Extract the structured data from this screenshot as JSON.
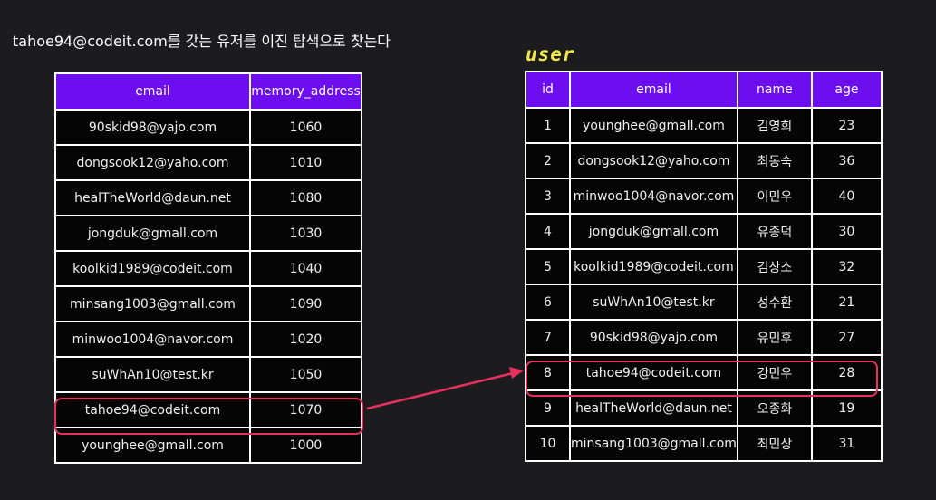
{
  "caption": "tahoe94@codeit.com를  갖는 유저를 이진 탐색으로 찾는다",
  "index_table": {
    "headers": [
      "email",
      "memory_address"
    ],
    "rows": [
      [
        "90skid98@yajo.com",
        "1060"
      ],
      [
        "dongsook12@yaho.com",
        "1010"
      ],
      [
        "healTheWorld@daun.net",
        "1080"
      ],
      [
        "jongduk@gmall.com",
        "1030"
      ],
      [
        "koolkid1989@codeit.com",
        "1040"
      ],
      [
        "minsang1003@gmall.com",
        "1090"
      ],
      [
        "minwoo1004@navor.com",
        "1020"
      ],
      [
        "suWhAn10@test.kr",
        "1050"
      ],
      [
        "tahoe94@codeit.com",
        "1070"
      ],
      [
        "younghee@gmall.com",
        "1000"
      ]
    ]
  },
  "user_table": {
    "title": "user",
    "headers": [
      "id",
      "email",
      "name",
      "age"
    ],
    "rows": [
      [
        "1",
        "younghee@gmall.com",
        "김영희",
        "23"
      ],
      [
        "2",
        "dongsook12@yaho.com",
        "최동숙",
        "36"
      ],
      [
        "3",
        "minwoo1004@navor.com",
        "이민우",
        "40"
      ],
      [
        "4",
        "jongduk@gmall.com",
        "유종덕",
        "30"
      ],
      [
        "5",
        "koolkid1989@codeit.com",
        "김상소",
        "32"
      ],
      [
        "6",
        "suWhAn10@test.kr",
        "성수환",
        "21"
      ],
      [
        "7",
        "90skid98@yajo.com",
        "유민후",
        "27"
      ],
      [
        "8",
        "tahoe94@codeit.com",
        "강민우",
        "28"
      ],
      [
        "9",
        "healTheWorld@daun.net",
        "오종화",
        "19"
      ],
      [
        "10",
        "minsang1003@gmall.com",
        "최민상",
        "31"
      ]
    ]
  },
  "colors": {
    "background": "#1c1c1e",
    "header": "#6d0ef0",
    "highlight": "#e8305e",
    "title": "#f2e84b"
  }
}
